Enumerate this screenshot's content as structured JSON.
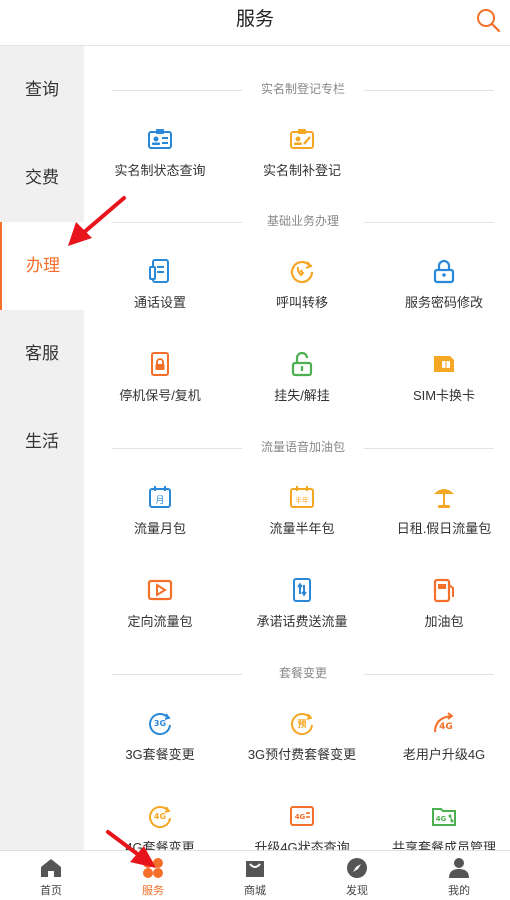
{
  "header": {
    "title": "服务"
  },
  "sidebar": {
    "items": [
      {
        "label": "查询"
      },
      {
        "label": "交费"
      },
      {
        "label": "办理",
        "active": true
      },
      {
        "label": "客服"
      },
      {
        "label": "生活"
      }
    ]
  },
  "sections": [
    {
      "title": "实名制登记专栏",
      "items": [
        {
          "label": "实名制状态查询",
          "icon": "id-card-icon"
        },
        {
          "label": "实名制补登记",
          "icon": "id-card-edit-icon"
        }
      ]
    },
    {
      "title": "基础业务办理",
      "items": [
        {
          "label": "通话设置",
          "icon": "phone-settings-icon"
        },
        {
          "label": "呼叫转移",
          "icon": "call-forward-icon"
        },
        {
          "label": "服务密码修改",
          "icon": "lock-icon"
        },
        {
          "label": "停机保号/复机",
          "icon": "phone-lock-icon"
        },
        {
          "label": "挂失/解挂",
          "icon": "unlock-icon"
        },
        {
          "label": "SIM卡换卡",
          "icon": "sim-card-icon"
        }
      ]
    },
    {
      "title": "流量语音加油包",
      "items": [
        {
          "label": "流量月包",
          "icon": "calendar-month-icon"
        },
        {
          "label": "流量半年包",
          "icon": "calendar-half-year-icon"
        },
        {
          "label": "日租.假日流量包",
          "icon": "beach-umbrella-icon"
        },
        {
          "label": "定向流量包",
          "icon": "play-icon"
        },
        {
          "label": "承诺话费送流量",
          "icon": "phone-data-icon"
        },
        {
          "label": "加油包",
          "icon": "fuel-icon"
        }
      ]
    },
    {
      "title": "套餐变更",
      "items": [
        {
          "label": "3G套餐变更",
          "icon": "3g-refresh-icon"
        },
        {
          "label": "3G预付费套餐变更",
          "icon": "prepaid-icon"
        },
        {
          "label": "老用户升级4G",
          "icon": "4g-upgrade-icon"
        },
        {
          "label": "4G套餐变更",
          "icon": "4g-refresh-icon"
        },
        {
          "label": "升级4G状态查询",
          "icon": "4g-status-icon"
        },
        {
          "label": "共享套餐成员管理",
          "icon": "folder-share-icon"
        }
      ]
    }
  ],
  "bottom_nav": [
    {
      "label": "首页",
      "icon": "home-icon"
    },
    {
      "label": "服务",
      "icon": "services-icon",
      "active": true
    },
    {
      "label": "商城",
      "icon": "shopping-bag-icon"
    },
    {
      "label": "发现",
      "icon": "compass-icon"
    },
    {
      "label": "我的",
      "icon": "user-icon"
    }
  ],
  "colors": {
    "accent": "#f46f2a",
    "blue": "#2a88d8",
    "orange": "#f5a623",
    "green": "#4caf50",
    "annotation": "#e8141b"
  }
}
